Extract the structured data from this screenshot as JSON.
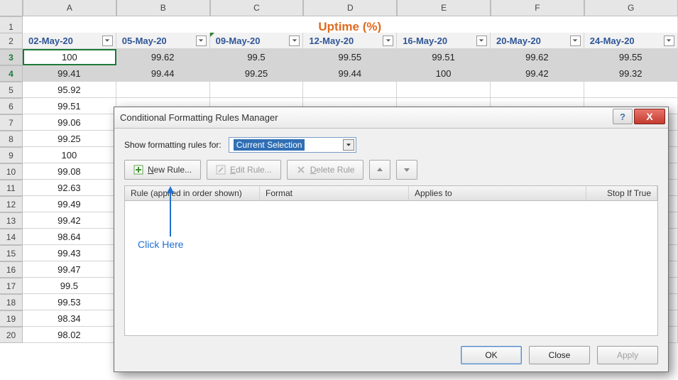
{
  "sheet": {
    "title": "Uptime (%)",
    "columns": [
      "A",
      "B",
      "C",
      "D",
      "E",
      "F",
      "G"
    ],
    "date_headers": [
      "02-May-20",
      "05-May-20",
      "09-May-20",
      "12-May-20",
      "16-May-20",
      "20-May-20",
      "24-May-20"
    ],
    "row3": [
      "100",
      "99.62",
      "99.5",
      "99.55",
      "99.51",
      "99.62",
      "99.55"
    ],
    "row4": [
      "99.41",
      "99.44",
      "99.25",
      "99.44",
      "100",
      "99.42",
      "99.32"
    ],
    "colA_rest": {
      "5": "95.92",
      "6": "99.51",
      "7": "99.06",
      "8": "99.25",
      "9": "100",
      "10": "99.08",
      "11": "92.63",
      "12": "99.49",
      "13": "99.42",
      "14": "98.64",
      "15": "99.43",
      "16": "99.47",
      "17": "99.5",
      "18": "99.53",
      "19": "98.34",
      "20": "98.02"
    }
  },
  "dialog": {
    "title": "Conditional Formatting Rules Manager",
    "show_for_label": "Show formatting rules for:",
    "show_for_value": "Current Selection",
    "new_rule": "New Rule...",
    "edit_rule": "Edit Rule...",
    "delete_rule": "Delete Rule",
    "cols": {
      "rule": "Rule (applied in order shown)",
      "format": "Format",
      "applies": "Applies to",
      "stop": "Stop If True"
    },
    "ok": "OK",
    "close": "Close",
    "apply": "Apply",
    "help": "?",
    "x": "X"
  },
  "annotation": {
    "text": "Click Here"
  }
}
